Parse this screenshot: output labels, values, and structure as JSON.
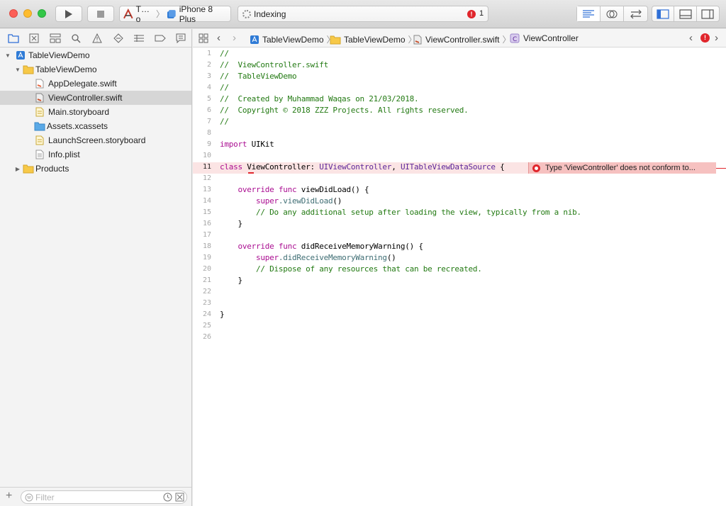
{
  "toolbar": {
    "scheme_target": "T…o",
    "scheme_device": "iPhone 8 Plus",
    "activity_status": "Indexing",
    "error_count": "1"
  },
  "navigator": {
    "tree": [
      {
        "label": "TableViewDemo",
        "icon": "project-icon",
        "depth": 0,
        "expanded": true
      },
      {
        "label": "TableViewDemo",
        "icon": "folder-icon",
        "depth": 1,
        "expanded": true
      },
      {
        "label": "AppDelegate.swift",
        "icon": "swift-file-icon",
        "depth": 2
      },
      {
        "label": "ViewController.swift",
        "icon": "swift-file-icon",
        "depth": 2,
        "selected": true
      },
      {
        "label": "Main.storyboard",
        "icon": "storyboard-icon",
        "depth": 2
      },
      {
        "label": "Assets.xcassets",
        "icon": "asset-catalog-icon",
        "depth": 2
      },
      {
        "label": "LaunchScreen.storyboard",
        "icon": "storyboard-icon",
        "depth": 2
      },
      {
        "label": "Info.plist",
        "icon": "plist-icon",
        "depth": 2
      },
      {
        "label": "Products",
        "icon": "folder-icon",
        "depth": 1,
        "expanded": false
      }
    ],
    "filter_placeholder": "Filter"
  },
  "jumpbar": {
    "crumbs": [
      "TableViewDemo",
      "TableViewDemo",
      "ViewController.swift",
      "ViewController"
    ]
  },
  "editor": {
    "line_numbers": [
      "1",
      "2",
      "3",
      "4",
      "5",
      "6",
      "7",
      "8",
      "9",
      "10",
      "11",
      "12",
      "13",
      "14",
      "15",
      "16",
      "17",
      "18",
      "19",
      "20",
      "21",
      "22",
      "23",
      "24",
      "25",
      "26"
    ],
    "current_line": "11",
    "lines": {
      "l1": "//",
      "l2": "//  ViewController.swift",
      "l3": "//  TableViewDemo",
      "l4": "//",
      "l5": "//  Created by Muhammad Waqas on 21/03/2018.",
      "l6": "//  Copyright © 2018 ZZZ Projects. All rights reserved.",
      "l7": "//",
      "l9_kw": "import",
      "l9_rest": " UIKit",
      "l11_kw": "class",
      "l11_name": " ViewController: ",
      "l11_t1": "UIViewController",
      "l11_sep": ", ",
      "l11_t2": "UITableViewDataSource",
      "l11_end": " {",
      "l13_kw1": "override",
      "l13_kw2": "func",
      "l13_rest": " viewDidLoad() {",
      "l14_kw": "super",
      "l14_fn": ".viewDidLoad",
      "l14_end": "()",
      "l15": "// Do any additional setup after loading the view, typically from a nib.",
      "l16": "}",
      "l18_kw1": "override",
      "l18_kw2": "func",
      "l18_rest": " didReceiveMemoryWarning() {",
      "l19_kw": "super",
      "l19_fn": ".didReceiveMemoryWarning",
      "l19_end": "()",
      "l20": "// Dispose of any resources that can be recreated.",
      "l21": "}",
      "l24": "}"
    },
    "error_message": "Type 'ViewController' does not conform to..."
  },
  "colors": {
    "comment": "#237a13",
    "keyword": "#aa0d91",
    "type": "#5c2699",
    "error_red": "#e0262c"
  }
}
